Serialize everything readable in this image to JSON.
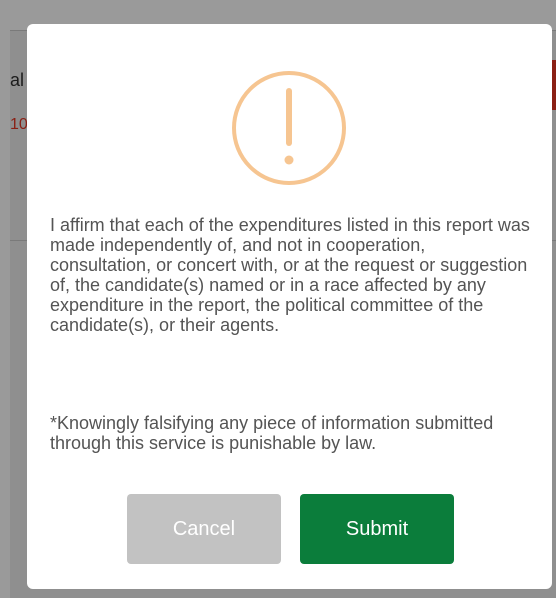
{
  "background": {
    "partial_text_1": "al",
    "partial_text_2": "10"
  },
  "dialog": {
    "icon": "warning-exclamation-icon",
    "icon_color": "#f6c591",
    "message": "I affirm that each of the expenditures listed in this report was made independently of, and not in cooperation, consultation, or concert with, or at the request or suggestion of, the candidate(s) named or in a race affected by any expenditure in the report, the political committee of the candidate(s), or their agents.",
    "notice": "*Knowingly falsifying any piece of information submitted through this service is punishable by law.",
    "cancel_label": "Cancel",
    "submit_label": "Submit",
    "cancel_color": "#c2c2c2",
    "submit_color": "#0b7d3b"
  }
}
